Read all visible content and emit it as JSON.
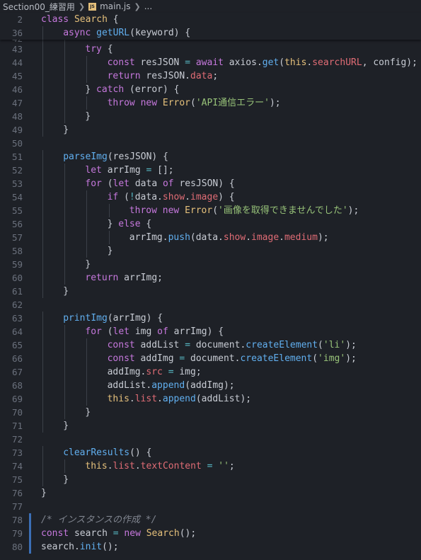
{
  "breadcrumb": {
    "folder": "Section00_練習用",
    "file_icon": "JS",
    "file": "main.js",
    "more": "..."
  },
  "lines": [
    {
      "n": "2",
      "sticky": true,
      "indent": 0,
      "tokens": [
        [
          "kw",
          "class"
        ],
        [
          "plain",
          " "
        ],
        [
          "cls",
          "Search"
        ],
        [
          "plain",
          " {"
        ]
      ]
    },
    {
      "n": "36",
      "sticky": true,
      "indent": 1,
      "tokens": [
        [
          "kw",
          "async"
        ],
        [
          "plain",
          " "
        ],
        [
          "fn",
          "getURL"
        ],
        [
          "plain",
          "(keyword) {"
        ]
      ]
    },
    {
      "n": "42",
      "cut": true,
      "indent": 2,
      "tokens": [
        [
          "plain",
          ""
        ]
      ]
    },
    {
      "n": "43",
      "indent": 2,
      "tokens": [
        [
          "kw",
          "try"
        ],
        [
          "plain",
          " {"
        ]
      ]
    },
    {
      "n": "44",
      "indent": 3,
      "tokens": [
        [
          "kw",
          "const"
        ],
        [
          "plain",
          " resJSON "
        ],
        [
          "op",
          "="
        ],
        [
          "plain",
          " "
        ],
        [
          "kw",
          "await"
        ],
        [
          "plain",
          " axios."
        ],
        [
          "fn",
          "get"
        ],
        [
          "plain",
          "("
        ],
        [
          "thisk",
          "this"
        ],
        [
          "plain",
          "."
        ],
        [
          "prop",
          "searchURL"
        ],
        [
          "plain",
          ", config);"
        ]
      ]
    },
    {
      "n": "45",
      "indent": 3,
      "tokens": [
        [
          "kw",
          "return"
        ],
        [
          "plain",
          " resJSON."
        ],
        [
          "prop",
          "data"
        ],
        [
          "plain",
          ";"
        ]
      ]
    },
    {
      "n": "46",
      "indent": 2,
      "tokens": [
        [
          "plain",
          "} "
        ],
        [
          "kw",
          "catch"
        ],
        [
          "plain",
          " (error) {"
        ]
      ]
    },
    {
      "n": "47",
      "indent": 3,
      "tokens": [
        [
          "kw",
          "throw"
        ],
        [
          "plain",
          " "
        ],
        [
          "kw",
          "new"
        ],
        [
          "plain",
          " "
        ],
        [
          "cls",
          "Error"
        ],
        [
          "plain",
          "("
        ],
        [
          "str",
          "'API通信エラー'"
        ],
        [
          "plain",
          ");"
        ]
      ]
    },
    {
      "n": "48",
      "indent": 2,
      "tokens": [
        [
          "plain",
          "}"
        ]
      ]
    },
    {
      "n": "49",
      "indent": 1,
      "tokens": [
        [
          "plain",
          "}"
        ]
      ]
    },
    {
      "n": "50",
      "indent": 0,
      "tokens": [
        [
          "plain",
          ""
        ]
      ]
    },
    {
      "n": "51",
      "indent": 1,
      "tokens": [
        [
          "fn",
          "parseImg"
        ],
        [
          "plain",
          "(resJSON) {"
        ]
      ]
    },
    {
      "n": "52",
      "indent": 2,
      "tokens": [
        [
          "kw",
          "let"
        ],
        [
          "plain",
          " arrImg "
        ],
        [
          "op",
          "="
        ],
        [
          "plain",
          " [];"
        ]
      ]
    },
    {
      "n": "53",
      "indent": 2,
      "tokens": [
        [
          "kw",
          "for"
        ],
        [
          "plain",
          " ("
        ],
        [
          "kw",
          "let"
        ],
        [
          "plain",
          " data "
        ],
        [
          "kw",
          "of"
        ],
        [
          "plain",
          " resJSON) {"
        ]
      ]
    },
    {
      "n": "54",
      "indent": 3,
      "tokens": [
        [
          "kw",
          "if"
        ],
        [
          "plain",
          " ("
        ],
        [
          "op",
          "!"
        ],
        [
          "plain",
          "data."
        ],
        [
          "prop",
          "show"
        ],
        [
          "plain",
          "."
        ],
        [
          "prop",
          "image"
        ],
        [
          "plain",
          ") {"
        ]
      ]
    },
    {
      "n": "55",
      "indent": 4,
      "tokens": [
        [
          "kw",
          "throw"
        ],
        [
          "plain",
          " "
        ],
        [
          "kw",
          "new"
        ],
        [
          "plain",
          " "
        ],
        [
          "cls",
          "Error"
        ],
        [
          "plain",
          "("
        ],
        [
          "str",
          "'画像を取得できませんでした'"
        ],
        [
          "plain",
          ");"
        ]
      ]
    },
    {
      "n": "56",
      "indent": 3,
      "tokens": [
        [
          "plain",
          "} "
        ],
        [
          "kw",
          "else"
        ],
        [
          "plain",
          " {"
        ]
      ]
    },
    {
      "n": "57",
      "indent": 4,
      "tokens": [
        [
          "plain",
          "arrImg."
        ],
        [
          "fn",
          "push"
        ],
        [
          "plain",
          "(data."
        ],
        [
          "prop",
          "show"
        ],
        [
          "plain",
          "."
        ],
        [
          "prop",
          "image"
        ],
        [
          "plain",
          "."
        ],
        [
          "prop",
          "medium"
        ],
        [
          "plain",
          ");"
        ]
      ]
    },
    {
      "n": "58",
      "indent": 3,
      "tokens": [
        [
          "plain",
          "}"
        ]
      ]
    },
    {
      "n": "59",
      "indent": 2,
      "tokens": [
        [
          "plain",
          "}"
        ]
      ]
    },
    {
      "n": "60",
      "indent": 2,
      "tokens": [
        [
          "kw",
          "return"
        ],
        [
          "plain",
          " arrImg;"
        ]
      ]
    },
    {
      "n": "61",
      "indent": 1,
      "tokens": [
        [
          "plain",
          "}"
        ]
      ]
    },
    {
      "n": "62",
      "indent": 0,
      "tokens": [
        [
          "plain",
          ""
        ]
      ]
    },
    {
      "n": "63",
      "indent": 1,
      "tokens": [
        [
          "fn",
          "printImg"
        ],
        [
          "plain",
          "(arrImg) {"
        ]
      ]
    },
    {
      "n": "64",
      "indent": 2,
      "tokens": [
        [
          "kw",
          "for"
        ],
        [
          "plain",
          " ("
        ],
        [
          "kw",
          "let"
        ],
        [
          "plain",
          " img "
        ],
        [
          "kw",
          "of"
        ],
        [
          "plain",
          " arrImg) {"
        ]
      ]
    },
    {
      "n": "65",
      "indent": 3,
      "tokens": [
        [
          "kw",
          "const"
        ],
        [
          "plain",
          " addList "
        ],
        [
          "op",
          "="
        ],
        [
          "plain",
          " document."
        ],
        [
          "fn",
          "createElement"
        ],
        [
          "plain",
          "("
        ],
        [
          "str",
          "'li'"
        ],
        [
          "plain",
          ");"
        ]
      ]
    },
    {
      "n": "66",
      "indent": 3,
      "tokens": [
        [
          "kw",
          "const"
        ],
        [
          "plain",
          " addImg "
        ],
        [
          "op",
          "="
        ],
        [
          "plain",
          " document."
        ],
        [
          "fn",
          "createElement"
        ],
        [
          "plain",
          "("
        ],
        [
          "str",
          "'img'"
        ],
        [
          "plain",
          ");"
        ]
      ]
    },
    {
      "n": "67",
      "indent": 3,
      "tokens": [
        [
          "plain",
          "addImg."
        ],
        [
          "prop",
          "src"
        ],
        [
          "plain",
          " "
        ],
        [
          "op",
          "="
        ],
        [
          "plain",
          " img;"
        ]
      ]
    },
    {
      "n": "68",
      "indent": 3,
      "tokens": [
        [
          "plain",
          "addList."
        ],
        [
          "fn",
          "append"
        ],
        [
          "plain",
          "(addImg);"
        ]
      ]
    },
    {
      "n": "69",
      "indent": 3,
      "tokens": [
        [
          "thisk",
          "this"
        ],
        [
          "plain",
          "."
        ],
        [
          "prop",
          "list"
        ],
        [
          "plain",
          "."
        ],
        [
          "fn",
          "append"
        ],
        [
          "plain",
          "(addList);"
        ]
      ]
    },
    {
      "n": "70",
      "indent": 2,
      "tokens": [
        [
          "plain",
          "}"
        ]
      ]
    },
    {
      "n": "71",
      "indent": 1,
      "tokens": [
        [
          "plain",
          "}"
        ]
      ]
    },
    {
      "n": "72",
      "indent": 0,
      "tokens": [
        [
          "plain",
          ""
        ]
      ]
    },
    {
      "n": "73",
      "indent": 1,
      "tokens": [
        [
          "fn",
          "clearResults"
        ],
        [
          "plain",
          "() {"
        ]
      ]
    },
    {
      "n": "74",
      "indent": 2,
      "tokens": [
        [
          "thisk",
          "this"
        ],
        [
          "plain",
          "."
        ],
        [
          "prop",
          "list"
        ],
        [
          "plain",
          "."
        ],
        [
          "prop",
          "textContent"
        ],
        [
          "plain",
          " "
        ],
        [
          "op",
          "="
        ],
        [
          "plain",
          " "
        ],
        [
          "str",
          "''"
        ],
        [
          "plain",
          ";"
        ]
      ]
    },
    {
      "n": "75",
      "indent": 1,
      "tokens": [
        [
          "plain",
          "}"
        ]
      ]
    },
    {
      "n": "76",
      "indent": 0,
      "tokens": [
        [
          "plain",
          "}"
        ]
      ]
    },
    {
      "n": "77",
      "indent": 0,
      "tokens": [
        [
          "plain",
          ""
        ]
      ]
    },
    {
      "n": "78",
      "indent": 0,
      "tokens": [
        [
          "cm",
          "/* インスタンスの作成 */"
        ]
      ]
    },
    {
      "n": "79",
      "indent": 0,
      "tokens": [
        [
          "kw",
          "const"
        ],
        [
          "plain",
          " search "
        ],
        [
          "op",
          "="
        ],
        [
          "plain",
          " "
        ],
        [
          "kw",
          "new"
        ],
        [
          "plain",
          " "
        ],
        [
          "cls",
          "Search"
        ],
        [
          "plain",
          "();"
        ]
      ]
    },
    {
      "n": "80",
      "indent": 0,
      "tokens": [
        [
          "plain",
          "search."
        ],
        [
          "fn",
          "init"
        ],
        [
          "plain",
          "();"
        ]
      ]
    }
  ]
}
